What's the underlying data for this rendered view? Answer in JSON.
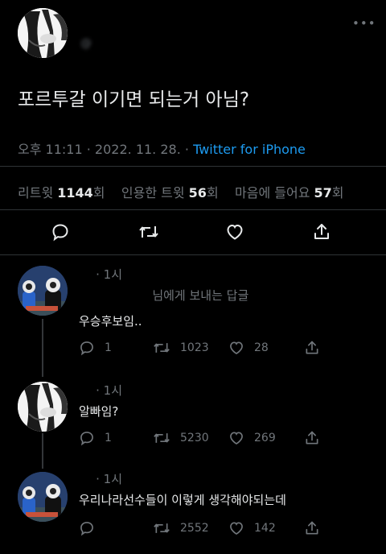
{
  "main_tweet": {
    "name": "",
    "handle": "@",
    "text": "포르투갈 이기면 되는거 아님?",
    "time": "오후 11:11",
    "sep": "·",
    "date": "2022. 11. 28.",
    "source": "Twitter for iPhone",
    "stats": {
      "retweet_label": "리트윗",
      "retweet_count": "1144",
      "retweet_unit": "회",
      "quote_label": "인용한 트윗",
      "quote_count": "56",
      "quote_unit": "회",
      "like_label": "마음에 들어요",
      "like_count": "57",
      "like_unit": "회"
    },
    "actions": [
      "reply-icon",
      "retweet-icon",
      "like-icon",
      "share-icon"
    ]
  },
  "replies": [
    {
      "name": "",
      "handle": "",
      "time": "· 1시",
      "reply_to_suffix": "님에게 보내는 답글",
      "text": "우승후보임..",
      "reply_count": "1",
      "retweet_count": "1023",
      "like_count": "28",
      "avatar": "photo"
    },
    {
      "name": "",
      "handle": "",
      "time": "· 1시",
      "text": "알빠임?",
      "reply_count": "1",
      "retweet_count": "5230",
      "like_count": "269",
      "avatar": "manga"
    },
    {
      "name": "",
      "handle": "",
      "time": "· 1시",
      "text": "우리나라선수들이 이렇게 생각해야되는데",
      "reply_count": "",
      "retweet_count": "2552",
      "like_count": "142",
      "avatar": "photo"
    }
  ],
  "colors": {
    "background": "#000000",
    "text": "#e7e9ea",
    "muted": "#71767b",
    "link": "#1d9bf0",
    "divider": "#2f3336"
  }
}
